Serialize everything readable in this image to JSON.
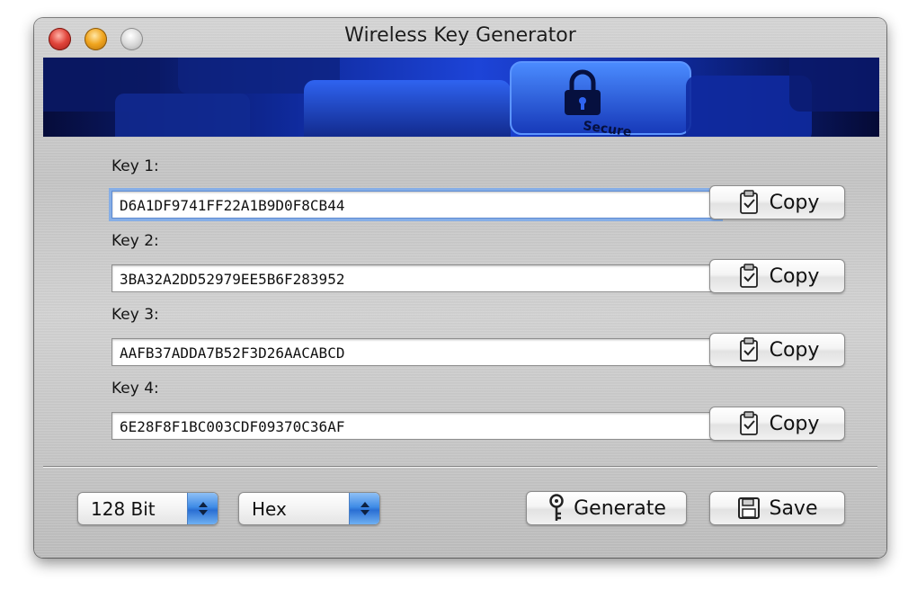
{
  "window": {
    "title": "Wireless Key Generator",
    "controls": [
      "close",
      "minimize",
      "zoom"
    ]
  },
  "banner": {
    "image": "blue-keyboard-secure-key-banner",
    "key_text": "Secure",
    "icon": "padlock-icon"
  },
  "keys": [
    {
      "label": "Key 1:",
      "value": "D6A1DF9741FF22A1B9D0F8CB44",
      "copy_label": "Copy"
    },
    {
      "label": "Key 2:",
      "value": "3BA32A2DD52979EE5B6F283952",
      "copy_label": "Copy"
    },
    {
      "label": "Key 3:",
      "value": "AAFB37ADDA7B52F3D26AACABCD",
      "copy_label": "Copy"
    },
    {
      "label": "Key 4:",
      "value": "6E28F8F1BC003CDF09370C36AF",
      "copy_label": "Copy"
    }
  ],
  "bottom": {
    "bit_select": "128 Bit",
    "format_select": "Hex",
    "generate_label": "Generate",
    "save_label": "Save"
  },
  "colors": {
    "close": "#e0443a",
    "minimize": "#f0a51f",
    "zoom": "#c8c8c8",
    "select_arrow": "#3f8be6",
    "banner": "#1d44d8"
  }
}
